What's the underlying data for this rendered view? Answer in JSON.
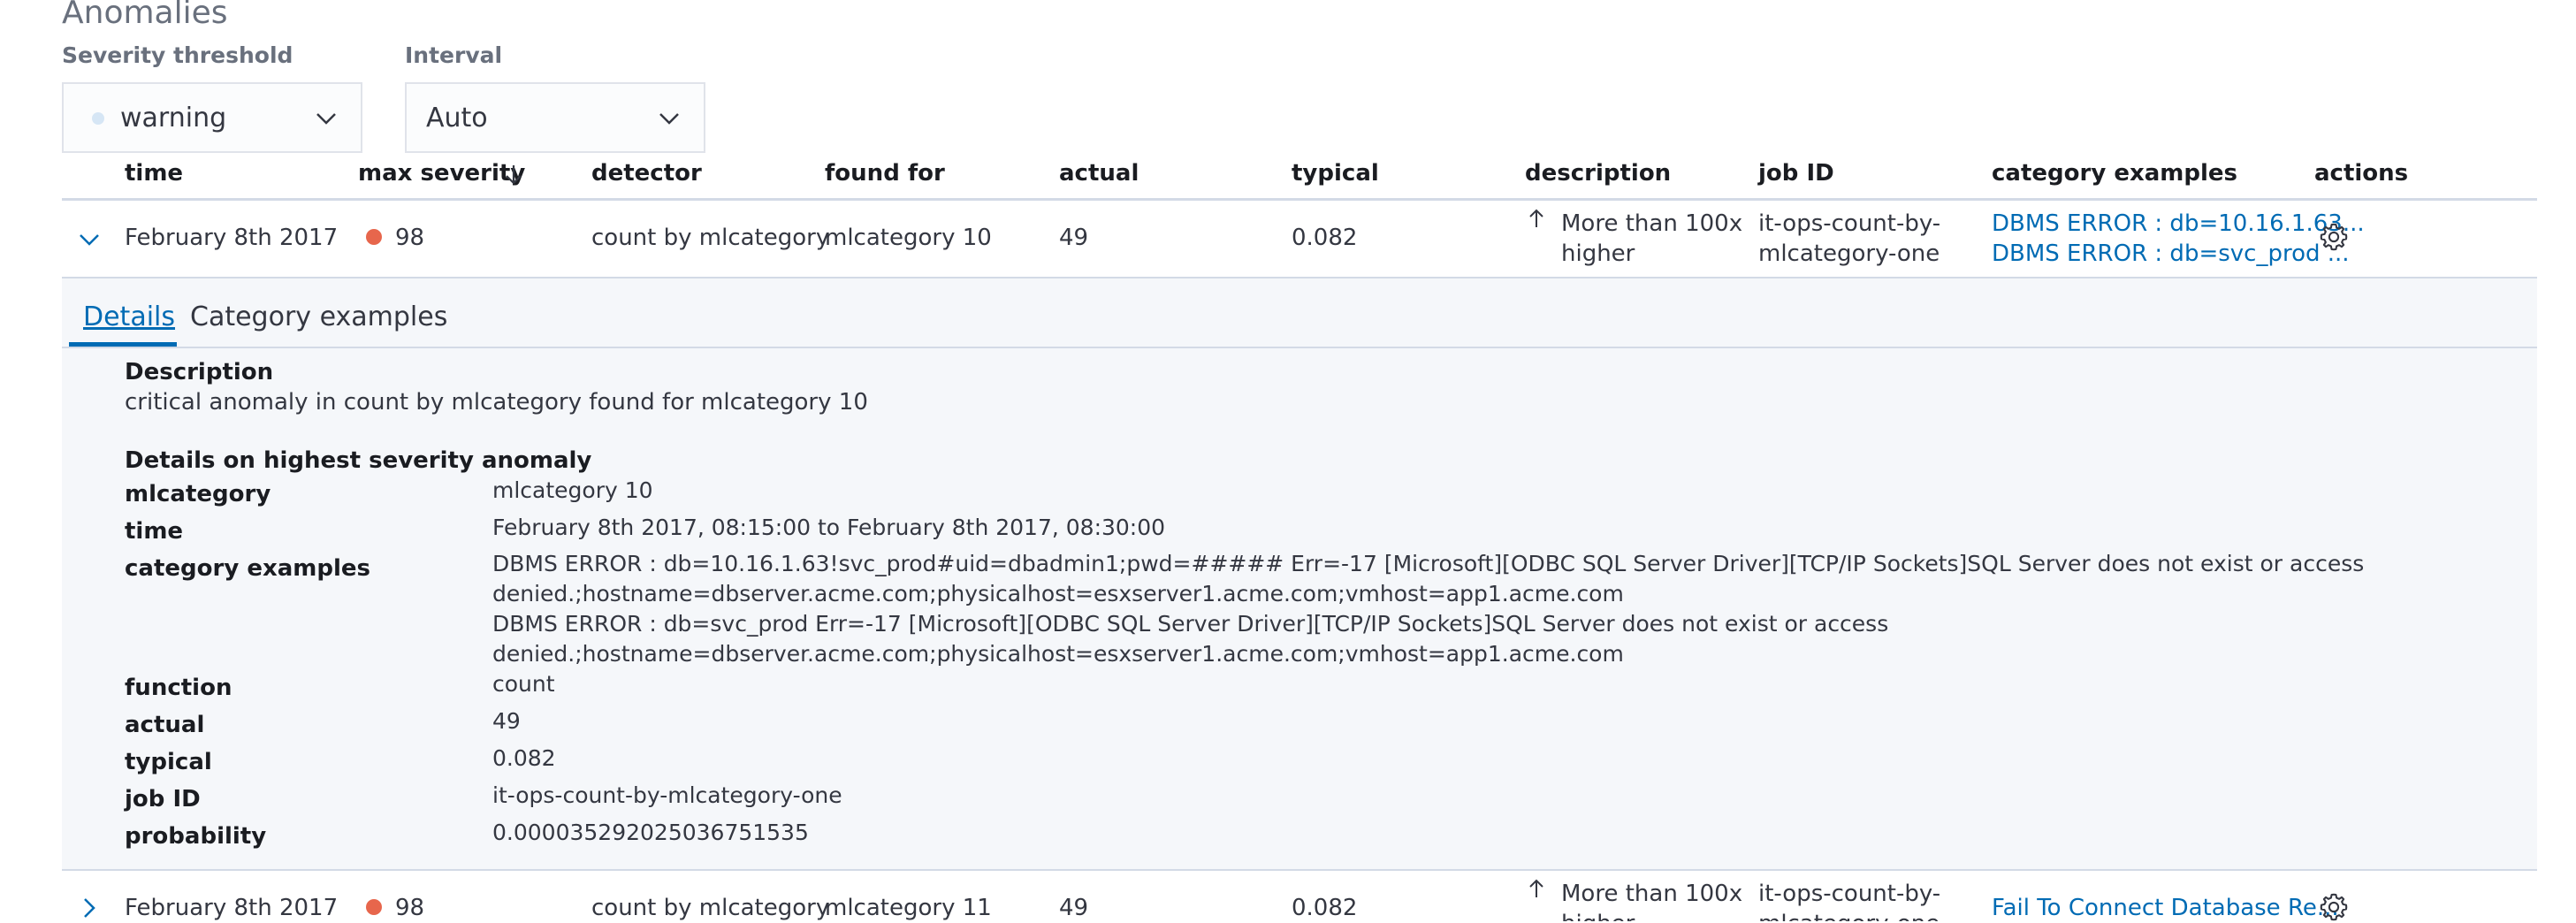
{
  "section_title": "Anomalies",
  "controls": {
    "severity_label": "Severity threshold",
    "severity_value": "warning",
    "interval_label": "Interval",
    "interval_value": "Auto"
  },
  "columns": {
    "time": "time",
    "max_severity": "max severity",
    "detector": "detector",
    "found_for": "found for",
    "actual": "actual",
    "typical": "typical",
    "description": "description",
    "job_id": "job ID",
    "category_examples": "category examples",
    "actions": "actions"
  },
  "rows": [
    {
      "time": "February 8th 2017",
      "severity": "98",
      "detector": "count by mlcategory",
      "found_for": "mlcategory 10",
      "actual": "49",
      "typical": "0.082",
      "description_line1": "More than 100x",
      "description_line2": "higher",
      "job_id_line1": "it-ops-count-by-",
      "job_id_line2": "mlcategory-one",
      "example1": "DBMS ERROR : db=10.16.1.63...",
      "example2": "DBMS ERROR : db=svc_prod ..."
    },
    {
      "time": "February 8th 2017",
      "severity": "98",
      "detector": "count by mlcategory",
      "found_for": "mlcategory 11",
      "actual": "49",
      "typical": "0.082",
      "description_line1": "More than 100x",
      "description_line2": "higher",
      "job_id_line1": "it-ops-count-by-",
      "job_id_line2": "mlcategory-one",
      "example1": "Fail To Connect Database Re..."
    }
  ],
  "details": {
    "tabs": [
      "Details",
      "Category examples"
    ],
    "description_heading": "Description",
    "description_text": "critical anomaly in count by mlcategory found for mlcategory 10",
    "highest_heading": "Details on highest severity anomaly",
    "fields": {
      "mlcategory_label": "mlcategory",
      "mlcategory_value": "mlcategory 10",
      "time_label": "time",
      "time_value": "February 8th 2017, 08:15:00 to February 8th 2017, 08:30:00",
      "examples_label": "category examples",
      "example_lines": [
        "DBMS ERROR : db=10.16.1.63!svc_prod#uid=dbadmin1;pwd=##### Err=-17 [Microsoft][ODBC SQL Server Driver][TCP/IP Sockets]SQL Server does not exist or access",
        "denied.;hostname=dbserver.acme.com;physicalhost=esxserver1.acme.com;vmhost=app1.acme.com",
        "DBMS ERROR : db=svc_prod Err=-17 [Microsoft][ODBC SQL Server Driver][TCP/IP Sockets]SQL Server does not exist or access",
        "denied.;hostname=dbserver.acme.com;physicalhost=esxserver1.acme.com;vmhost=app1.acme.com"
      ],
      "function_label": "function",
      "function_value": "count",
      "actual_label": "actual",
      "actual_value": "49",
      "typical_label": "typical",
      "typical_value": "0.082",
      "job_label": "job ID",
      "job_value": "it-ops-count-by-mlcategory-one",
      "probability_label": "probability",
      "probability_value": "0.000035292025036751535"
    }
  },
  "colors": {
    "critical": "#e7664c",
    "link": "#006bb4",
    "warning_dot": "#d6e6f5"
  },
  "icons": [
    "chevron-down-icon",
    "chevron-right-icon",
    "arrow-down-icon",
    "arrow-up-icon",
    "gear-icon"
  ]
}
